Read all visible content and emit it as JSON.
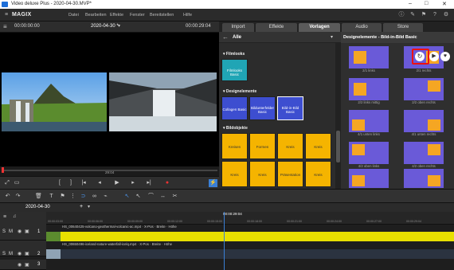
{
  "title_bar": {
    "title": "Video deluxe Plus - 2020-04-30.MVP*"
  },
  "menu": {
    "logo": "MAGIX",
    "items": [
      "Datei",
      "Bearbeiten",
      "Effekte",
      "Fenster",
      "Bereitstellen",
      "Hilfe"
    ]
  },
  "tabs": [
    "Import",
    "Effekte",
    "Vorlagen",
    "Audio",
    "Store"
  ],
  "active_tab": "Vorlagen",
  "preview": {
    "time_left": "00:00:00:00",
    "project": "2020-04-30 *",
    "time_right": "00:00:29:04",
    "scrub_time": "29:04"
  },
  "browser": {
    "dropdown": "Alle",
    "sections": [
      {
        "title": "Filmlooks",
        "tiles": [
          "Filmlooks Basic"
        ]
      },
      {
        "title": "Designelemente",
        "tiles": [
          "Collagen Basic",
          "Bildunterfelder Basic",
          "Bild-in-Bild Basic"
        ]
      },
      {
        "title": "Bildobjekte",
        "tiles": [
          "Kreisen",
          "Formen",
          "Kreis",
          "Kreis",
          "Kreis",
          "Kreis",
          "Präsentation",
          "Kreis"
        ]
      }
    ]
  },
  "panel": {
    "title": "Designelemente - Bild-in-Bild Basic",
    "cells": [
      "2/1 links",
      "2/1 rechts",
      "2/2 links mittig",
      "2/2 oben rechts",
      "4/1 unten links",
      "4/1 unten rechts",
      "4/2 oben links",
      "4/2 oben rechts",
      "4/3 unten links",
      "4/3 unten rechts"
    ]
  },
  "timeline": {
    "project": "2020-04-30",
    "ruler_marks": [
      "00:00:03:00",
      "00:00:06:00",
      "00:00:09:00",
      "00:00:12:00",
      "00:00:15:00",
      "00:00:18:00",
      "00:00:21:00",
      "00:00:24:00",
      "00:00:27:00",
      "00:00:29:04"
    ],
    "ruler_center": "00:00:29:04",
    "tracks": [
      {
        "num": "1",
        "clip": "HS_00640425-volcano-geothermal-volcanic-ac.mp4 · X-Pos · Breite · Höhe"
      },
      {
        "num": "2",
        "clip": "HS_00650496-iceland-nature-waterfall-icelq.mp4 · X-Pos · Breite · Höhe"
      },
      {
        "num": "3",
        "clip": ""
      }
    ]
  },
  "colors": {
    "accent": "#4a8fe0",
    "clip": "#e8e000",
    "tile": "#f5b400",
    "cell": "#6a5ad8",
    "orange": "#f5a623"
  }
}
